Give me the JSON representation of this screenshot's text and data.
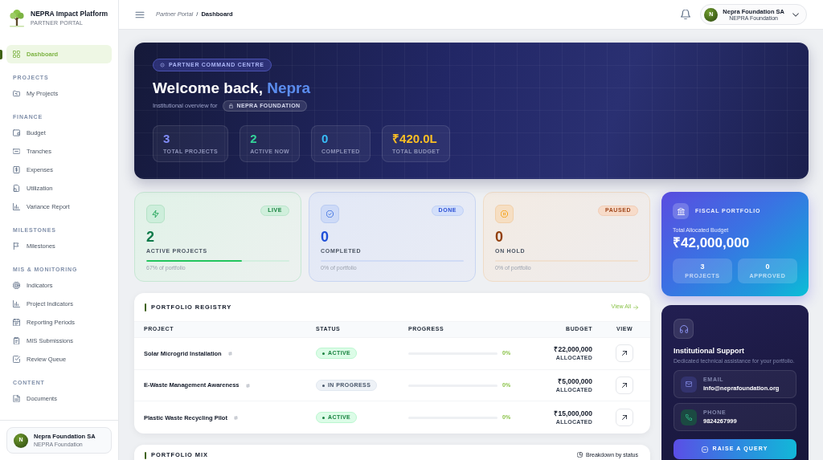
{
  "sidebar": {
    "brand": {
      "title": "NEPRA Impact Platform",
      "subtitle": "PARTNER PORTAL"
    },
    "sections": [
      {
        "items": [
          {
            "label": "Dashboard",
            "selected": true
          }
        ]
      },
      {
        "heading": "PROJECTS",
        "items": [
          {
            "label": "My Projects",
            "selected": false
          }
        ]
      },
      {
        "heading": "FINANCE",
        "items": [
          {
            "label": "Budget",
            "selected": false
          },
          {
            "label": "Tranches",
            "selected": false
          },
          {
            "label": "Expenses",
            "selected": false
          },
          {
            "label": "Utilization",
            "selected": false
          },
          {
            "label": "Variance Report",
            "selected": false
          }
        ]
      },
      {
        "heading": "MILESTONES",
        "items": [
          {
            "label": "Milestones",
            "selected": false
          }
        ]
      },
      {
        "heading": "MIS & MONITORING",
        "items": [
          {
            "label": "Indicators",
            "selected": false
          },
          {
            "label": "Project Indicators",
            "selected": false
          },
          {
            "label": "Reporting Periods",
            "selected": false
          },
          {
            "label": "MIS Submissions",
            "selected": false
          },
          {
            "label": "Review Queue",
            "selected": false
          }
        ]
      },
      {
        "heading": "CONTENT",
        "items": [
          {
            "label": "Documents",
            "selected": false
          }
        ]
      }
    ],
    "profile": {
      "initial": "N",
      "name": "Nepra Foundation SA",
      "org": "NEPRA Foundation"
    }
  },
  "header": {
    "breadcrumb": [
      {
        "label": "Partner Portal",
        "current": false
      },
      {
        "label": "Dashboard",
        "current": true
      }
    ],
    "separator": "/",
    "account": {
      "initial": "N",
      "name": "Nepra Foundation SA",
      "org": "NEPRA Foundation"
    }
  },
  "hero": {
    "badge": "PARTNER COMMAND CENTRE",
    "greeting": "Welcome back,",
    "name": "Nepra",
    "subtitle": "Institutional overview for",
    "org_chip": "NEPRA FOUNDATION",
    "stats": [
      {
        "value": "3",
        "label": "TOTAL PROJECTS",
        "color": "#818cf8"
      },
      {
        "value": "2",
        "label": "ACTIVE NOW",
        "color": "#34d399"
      },
      {
        "value": "0",
        "label": "COMPLETED",
        "color": "#38bdf8"
      },
      {
        "value": "₹420.0L",
        "label": "TOTAL BUDGET",
        "color": "#fbbf24"
      }
    ]
  },
  "status_cards": [
    {
      "kind": "active",
      "badge": "LIVE",
      "value": "2",
      "label": "ACTIVE PROJECTS",
      "level": 0.67,
      "caption": "67% of portfolio"
    },
    {
      "kind": "completed",
      "badge": "DONE",
      "value": "0",
      "label": "COMPLETED",
      "level": 0,
      "caption": "0% of portfolio"
    },
    {
      "kind": "paused",
      "badge": "PAUSED",
      "value": "0",
      "label": "ON HOLD",
      "level": 0,
      "caption": "0% of portfolio"
    }
  ],
  "registry": {
    "title": "PORTFOLIO REGISTRY",
    "link": "View All",
    "columns": [
      "PROJECT",
      "STATUS",
      "PROGRESS",
      "BUDGET",
      "VIEW"
    ],
    "rows": [
      {
        "project": "Solar Microgrid Installation",
        "status": {
          "label": "ACTIVE",
          "kind": "active"
        },
        "level": 0,
        "progress": "0%",
        "budget": "₹22,000,000",
        "budget_note": "ALLOCATED"
      },
      {
        "project": "E-Waste Management Awareness",
        "status": {
          "label": "IN PROGRESS",
          "kind": "in_progress"
        },
        "level": 0,
        "progress": "0%",
        "budget": "₹5,000,000",
        "budget_note": "ALLOCATED"
      },
      {
        "project": "Plastic Waste Recycling Pilot",
        "status": {
          "label": "ACTIVE",
          "kind": "active"
        },
        "level": 0,
        "progress": "0%",
        "budget": "₹15,000,000",
        "budget_note": "ALLOCATED"
      }
    ]
  },
  "portfolio_mix": {
    "title": "PORTFOLIO MIX",
    "note": "Breakdown by status"
  },
  "fiscal": {
    "title": "FISCAL PORTFOLIO",
    "budget_label": "Total Allocated Budget",
    "budget": "₹42,000,000",
    "stats": [
      {
        "value": "3",
        "label": "PROJECTS"
      },
      {
        "value": "0",
        "label": "APPROVED"
      }
    ]
  },
  "support": {
    "title": "Institutional Support",
    "description": "Dedicated technical assistance for your portfolio.",
    "contacts": [
      {
        "kind": "email",
        "label": "EMAIL",
        "value": "info@neprafoundation.org"
      },
      {
        "kind": "phone",
        "label": "PHONE",
        "value": "9824267999"
      }
    ],
    "button": "RAISE A QUERY"
  }
}
